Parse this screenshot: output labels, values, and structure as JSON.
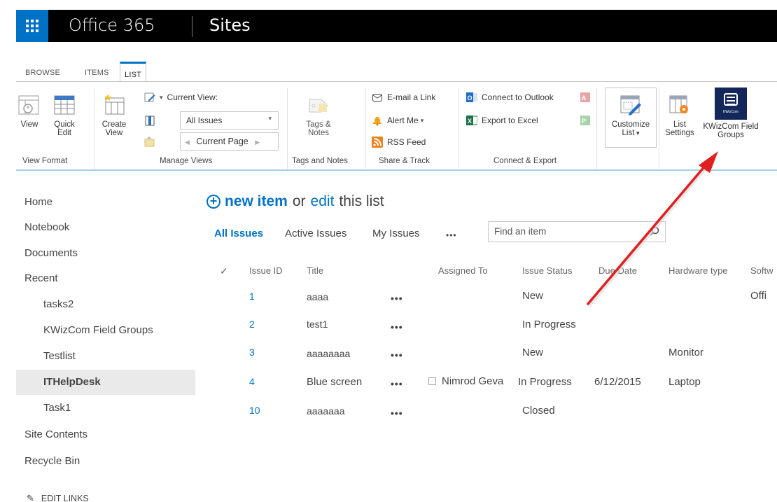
{
  "suite": {
    "brand": "Office 365",
    "app": "Sites"
  },
  "ribbon_tabs": [
    "BROWSE",
    "ITEMS",
    "LIST"
  ],
  "ribbon": {
    "view_format": {
      "view": "View",
      "quick_edit_line1": "Quick",
      "quick_edit_line2": "Edit",
      "label": "View Format"
    },
    "manage_views": {
      "create_view_line1": "Create",
      "create_view_line2": "View",
      "current_view_label": "Current View:",
      "current_view_value": "All Issues",
      "current_page": "Current Page",
      "label": "Manage Views"
    },
    "tags": {
      "line1": "Tags &",
      "line2": "Notes",
      "label": "Tags and Notes"
    },
    "share": {
      "email": "E-mail a Link",
      "alert": "Alert Me",
      "rss": "RSS Feed",
      "label": "Share & Track"
    },
    "connect": {
      "outlook": "Connect to Outlook",
      "excel": "Export to Excel",
      "label": "Connect & Export"
    },
    "customize": {
      "line1": "Customize",
      "line2": "List"
    },
    "settings": {
      "line1": "List",
      "line2": "Settings"
    },
    "kwiz": {
      "line1": "KWizCom Field",
      "line2": "Groups",
      "logo_text": "KWizCom"
    }
  },
  "leftnav": {
    "items": [
      "Home",
      "Notebook",
      "Documents",
      "Recent"
    ],
    "recent": [
      "tasks2",
      "KWizCom Field Groups",
      "Testlist",
      "ITHelpDesk",
      "Task1"
    ],
    "bottom": [
      "Site Contents",
      "Recycle Bin"
    ],
    "edit_links": "EDIT LINKS"
  },
  "main": {
    "new_item": "new item",
    "or": "or",
    "edit": "edit",
    "this_list": "this list",
    "views": [
      "All Issues",
      "Active Issues",
      "My Issues"
    ],
    "more_views": "•••",
    "search_placeholder": "Find an item",
    "columns": [
      "Issue ID",
      "Title",
      "Assigned To",
      "Issue Status",
      "Due Date",
      "Hardware type",
      "Softw"
    ],
    "rows": [
      {
        "id": "1",
        "title": "aaaa",
        "assigned": "",
        "status": "New",
        "due": "",
        "hardware": "",
        "software": "Offi"
      },
      {
        "id": "2",
        "title": "test1",
        "assigned": "",
        "status": "In Progress",
        "due": "",
        "hardware": "",
        "software": ""
      },
      {
        "id": "3",
        "title": "aaaaaaaa",
        "assigned": "",
        "status": "New",
        "due": "",
        "hardware": "Monitor",
        "software": ""
      },
      {
        "id": "4",
        "title": "Blue screen",
        "assigned": "Nimrod Geva",
        "status": "In Progress",
        "due": "6/12/2015",
        "hardware": "Laptop",
        "software": ""
      },
      {
        "id": "10",
        "title": "aaaaaaa",
        "assigned": "",
        "status": "Closed",
        "due": "",
        "hardware": "",
        "software": ""
      }
    ],
    "row_menu": "•••"
  },
  "colors": {
    "accent": "#0072c6",
    "annotation_arrow": "#e02020"
  }
}
